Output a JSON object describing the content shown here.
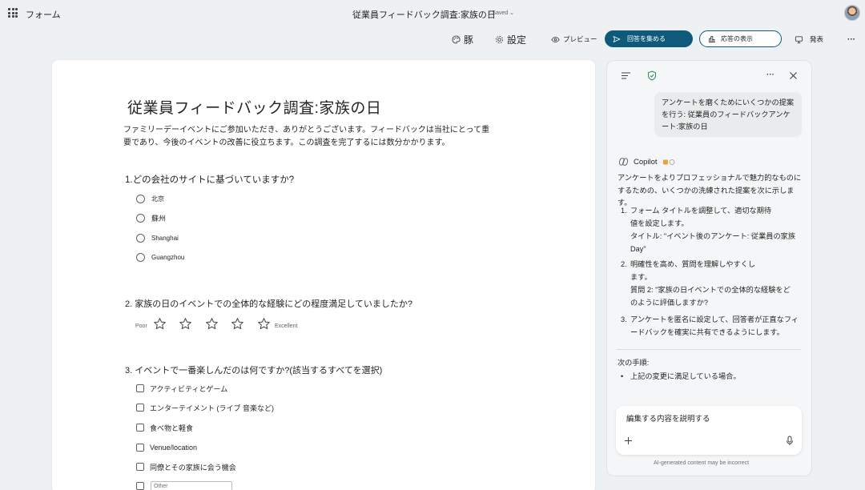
{
  "header": {
    "app_name": "フォーム",
    "doc_title": "従業員フィードバック調査:家族の日",
    "saved_label": "- Saved ⌄"
  },
  "toolbar": {
    "theme_label": "豚",
    "settings_label": "設定",
    "preview_label": "プレビュー",
    "collect_label": "回答を集める",
    "responses_label": "応答の表示",
    "present_label": "発表",
    "more_label": "···"
  },
  "form": {
    "title": "従業員フィードバック調査:家族の日",
    "description": "ファミリーデーイベントにご参加いただき、ありがとうございます。フィードバックは当社にとって重要であり、今後のイベントの改善に役立ちます。この調査を完了するには数分かかります。",
    "q1": {
      "title": "1.どの会社のサイトに基づいていますか?",
      "options": [
        "北京",
        "蘇州",
        "Shanghai",
        "Guangzhou"
      ]
    },
    "q2": {
      "title": "2. 家族の日のイベントでの全体的な経験にどの程度満足していましたか?",
      "low_label": "Poor",
      "high_label": "Excellent",
      "stars": 5
    },
    "q3": {
      "title": "3. イベントで一番楽しんだのは何ですか?(該当するすべてを選択)",
      "options": [
        "アクティビティとゲーム",
        "エンターテイメント (ライブ 音楽など)",
        "食べ物と軽食",
        "Venue/location",
        "同僚とその家族に会う機会"
      ],
      "other_placeholder": "Other"
    }
  },
  "copilot": {
    "user_message": "アンケートを磨くためにいくつかの提案を行う: 従業員のフィードバックアンケート:家族の日",
    "brand": "Copilot",
    "intro": "アンケートをよりプロフェッショナルで魅力的なものにするための、いくつかの洗練された提案を次に示します。",
    "suggestions": [
      {
        "num": "1.",
        "text": "フォーム タイトルを調整して、適切な期待値を設定します。",
        "detail": "タイトル: \"イベント後のアンケート: 従業員の家族 Day\""
      },
      {
        "num": "2.",
        "text": "明確性を高め、質問を理解しやすくします。",
        "detail": "質問 2: \"家族の日イベントでの全体的な経験をどのように評価しますか?"
      },
      {
        "num": "3.",
        "text": "アンケートを匿名に設定して、回答者が正直なフィードバックを確実に共有できるようにします。",
        "detail": ""
      }
    ],
    "next_steps_label": "次の手順:",
    "next_steps": [
      "上記の変更に満足している場合。"
    ],
    "composer_placeholder": "編集する内容を説明する",
    "disclaimer": "AI-generated content may be incorrect"
  },
  "colors": {
    "accent": "#0f5a7a",
    "background": "#eef1f3",
    "shield_green": "#2e8b57"
  }
}
